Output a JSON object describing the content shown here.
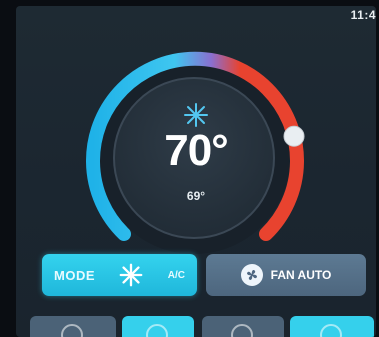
{
  "status_bar": {
    "time": "11:4"
  },
  "thermostat": {
    "setpoint": "70°",
    "current": "69°",
    "mode_icon": "snowflake-icon",
    "knob_position_fraction": 0.78,
    "colors": {
      "cool": "#2cc3ec",
      "heat": "#e8432f",
      "track": "#1a222a",
      "dial": "#27333f"
    }
  },
  "controls": {
    "mode_button": {
      "label": "MODE",
      "icon": "snowflake-icon",
      "value": "A/C",
      "color": "#34d3ee"
    },
    "fan_button": {
      "icon": "fan-icon",
      "label": "FAN AUTO",
      "color": "#56708a"
    }
  },
  "bottom_tiles": [
    {
      "icon": "circle-icon",
      "active": false
    },
    {
      "icon": "circle-icon",
      "active": true
    },
    {
      "icon": "circle-icon",
      "active": false
    },
    {
      "icon": "circle-icon",
      "active": true
    }
  ]
}
